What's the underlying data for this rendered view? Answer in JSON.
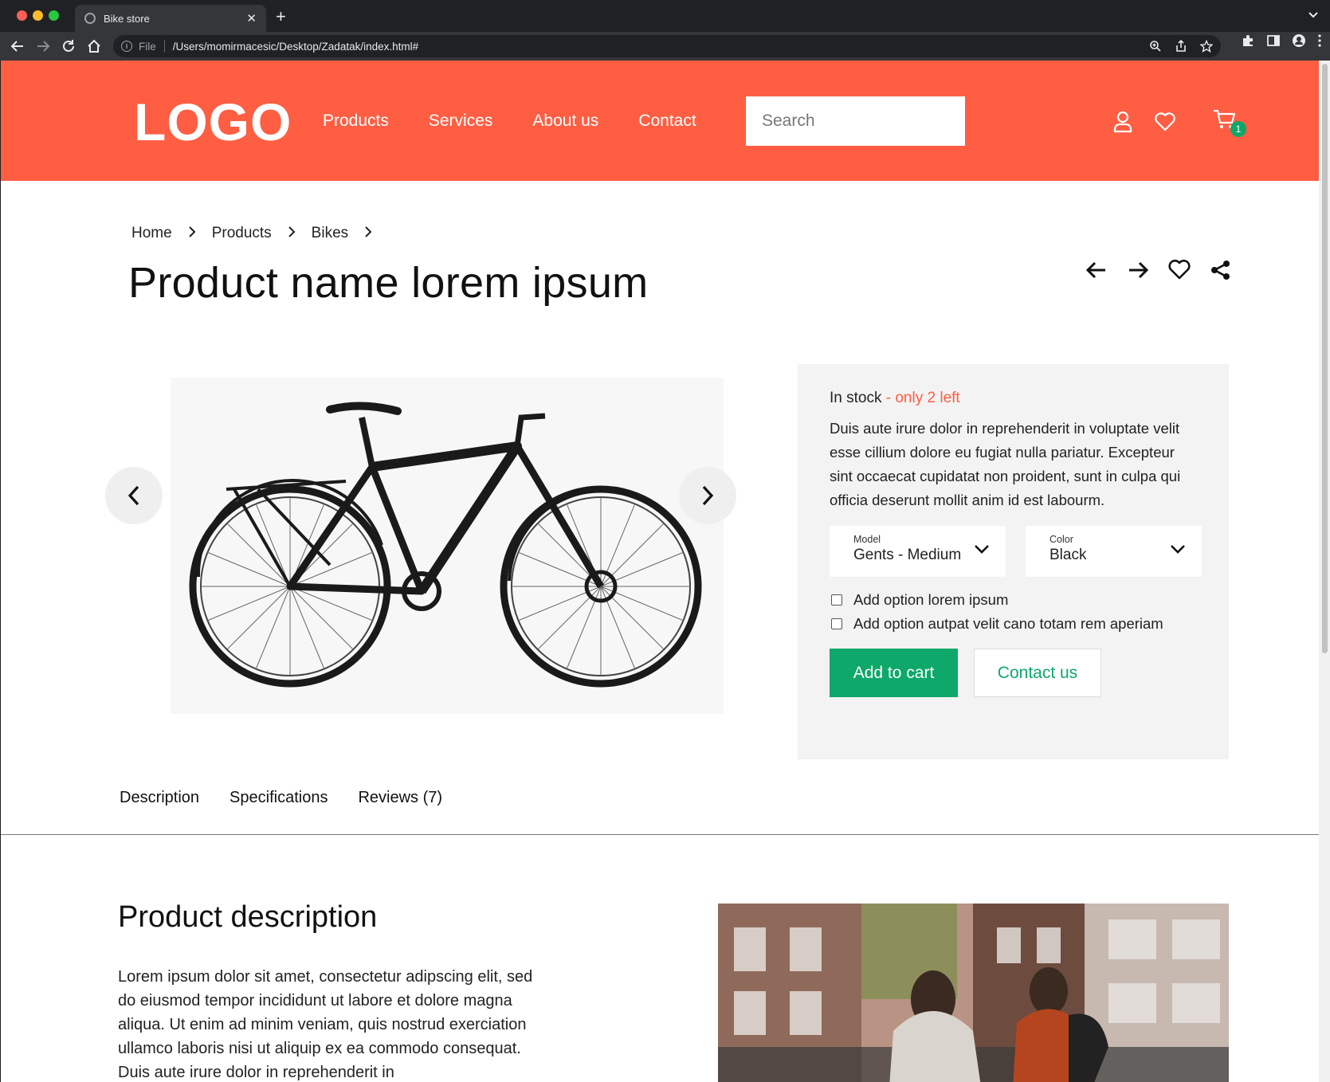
{
  "browser": {
    "tab_title": "Bike store",
    "url_scheme": "File",
    "url": "/Users/momirmacesic/Desktop/Zadatak/index.html#"
  },
  "header": {
    "logo": "LOGO",
    "nav": [
      "Products",
      "Services",
      "About us",
      "Contact"
    ],
    "search_placeholder": "Search",
    "cart_count": "1",
    "brand_color": "#ff5e43"
  },
  "breadcrumb": [
    "Home",
    "Products",
    "Bikes"
  ],
  "product": {
    "name": "Product name lorem ipsum",
    "stock_label": "In stock",
    "stock_warning": " - only 2 left",
    "short_description": "Duis aute irure dolor in reprehenderit in voluptate velit esse cillium dolore eu fugiat nulla pariatur. Excepteur sint occaecat cupidatat non proident, sunt in culpa qui officia deserunt mollit anim id est labourm.",
    "model_label": "Model",
    "model_value": "Gents - Medium",
    "color_label": "Color",
    "color_value": "Black",
    "option_1": "Add option lorem ipsum",
    "option_2": "Add option autpat velit cano totam rem aperiam",
    "add_to_cart": "Add to cart",
    "contact_us": "Contact us",
    "accent_color": "#0ea86a"
  },
  "tabs": [
    "Description",
    "Specifications",
    "Reviews (7)"
  ],
  "description": {
    "title": "Product description",
    "body": "Lorem ipsum dolor sit amet, consectetur adipscing elit, sed do eiusmod tempor incididunt ut labore et dolore magna aliqua. Ut enim ad minim veniam, quis nostrud exerciation ullamco laboris nisi ut aliquip ex ea commodo consequat. Duis aute irure dolor in reprehenderit in"
  }
}
